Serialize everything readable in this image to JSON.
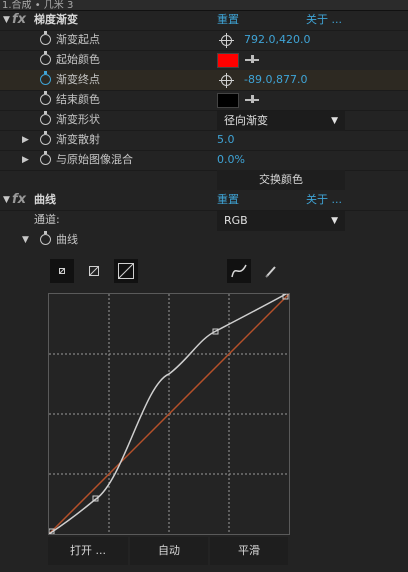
{
  "tab_title": "1.合成 • 几米 3",
  "gradient": {
    "title": "梯度渐变",
    "reset": "重置",
    "about": "关于 ...",
    "start_point": {
      "label": "渐变起点",
      "value": "792.0,420.0"
    },
    "start_color": {
      "label": "起始颜色",
      "color": "#ff0000"
    },
    "end_point": {
      "label": "渐变终点",
      "value": "-89.0,877.0"
    },
    "end_color": {
      "label": "结束颜色",
      "color": "#000000"
    },
    "shape": {
      "label": "渐变形状",
      "value": "径向渐变"
    },
    "scatter": {
      "label": "渐变散射",
      "value": "5.0"
    },
    "blend": {
      "label": "与原始图像混合",
      "value": "0.0%"
    },
    "swap_button": "交换颜色"
  },
  "curves": {
    "title": "曲线",
    "reset": "重置",
    "about": "关于 ...",
    "channel_label": "通道:",
    "channel_value": "RGB",
    "curve_label": "曲线",
    "open_button": "打开 ...",
    "auto_button": "自动",
    "smooth_button": "平滑",
    "icons": [
      "size-small-icon",
      "size-medium-icon",
      "size-large-icon",
      "bezier-curve-icon",
      "pencil-icon"
    ]
  }
}
